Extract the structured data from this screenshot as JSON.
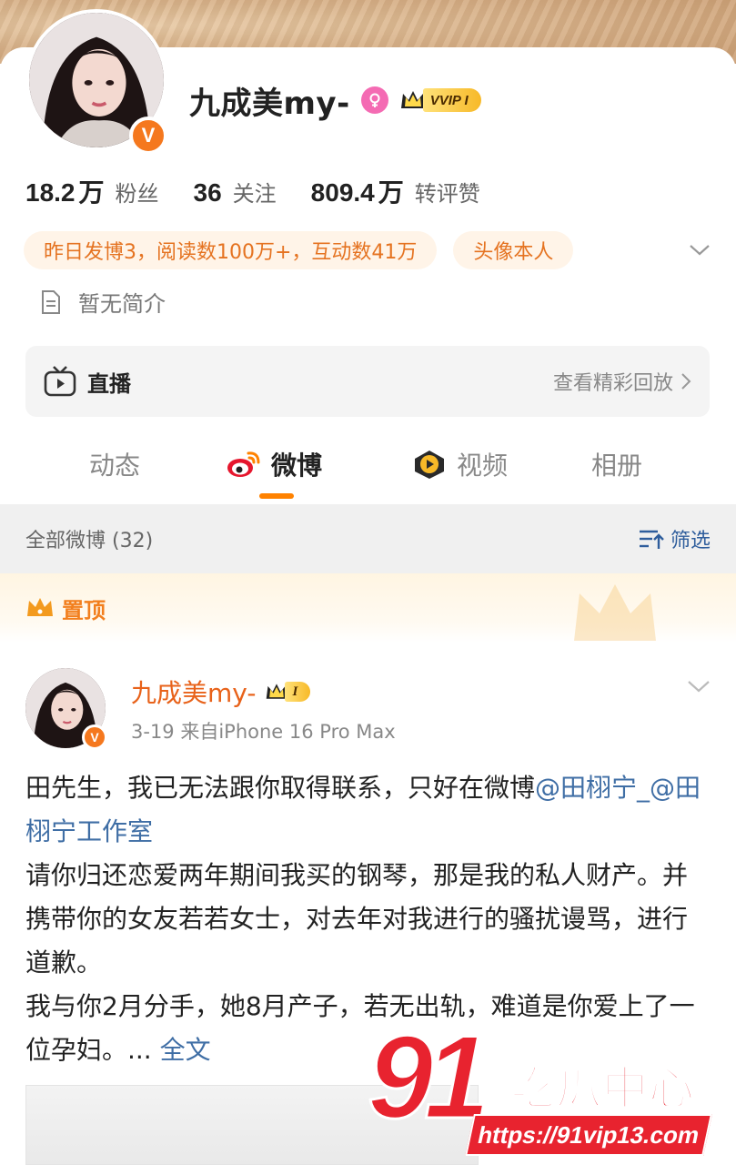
{
  "profile": {
    "username": "九成美my-",
    "vip_badge": "VVIP I",
    "verified_mark": "V",
    "stats": [
      {
        "num": "18.2",
        "unit": "万",
        "label": "粉丝"
      },
      {
        "num": "36",
        "unit": "",
        "label": "关注"
      },
      {
        "num": "809.4",
        "unit": "万",
        "label": "转评赞"
      }
    ],
    "tags": [
      "昨日发博3，阅读数100万+，互动数41万",
      "头像本人"
    ],
    "bio": "暂无简介"
  },
  "live": {
    "label": "直播",
    "link": "查看精彩回放"
  },
  "tabs": [
    {
      "label": "动态",
      "active": false
    },
    {
      "label": "微博",
      "active": true
    },
    {
      "label": "视频",
      "active": false
    },
    {
      "label": "相册",
      "active": false
    }
  ],
  "filter": {
    "count_label": "全部微博 (32)",
    "button": "筛选"
  },
  "pinned": {
    "label": "置顶"
  },
  "post": {
    "author": "九成美my-",
    "vip_badge": "I",
    "meta": "3-19  来自iPhone 16 Pro Max",
    "text_1": "田先生，我已无法跟你取得联系，只好在微博",
    "mention_1": "@田栩宁_",
    "mention_2": "@田栩宁工作室",
    "text_2": "请你归还恋爱两年期间我买的钢琴，那是我的私人财产。并携带你的女友若若女士，对去年对我进行的骚扰谩骂，进行道歉。",
    "text_3": "我与你2月分手，她8月产子，若无出轨，难道是你爱上了一位孕妇。...",
    "more": "全文"
  },
  "watermark": {
    "number": "91",
    "title": "吃瓜中心",
    "url": "https://91vip13.com"
  },
  "colors": {
    "accent": "#ff8200",
    "link": "#3f6ea5",
    "author": "#e8621a",
    "watermark_red": "#e8232f"
  }
}
